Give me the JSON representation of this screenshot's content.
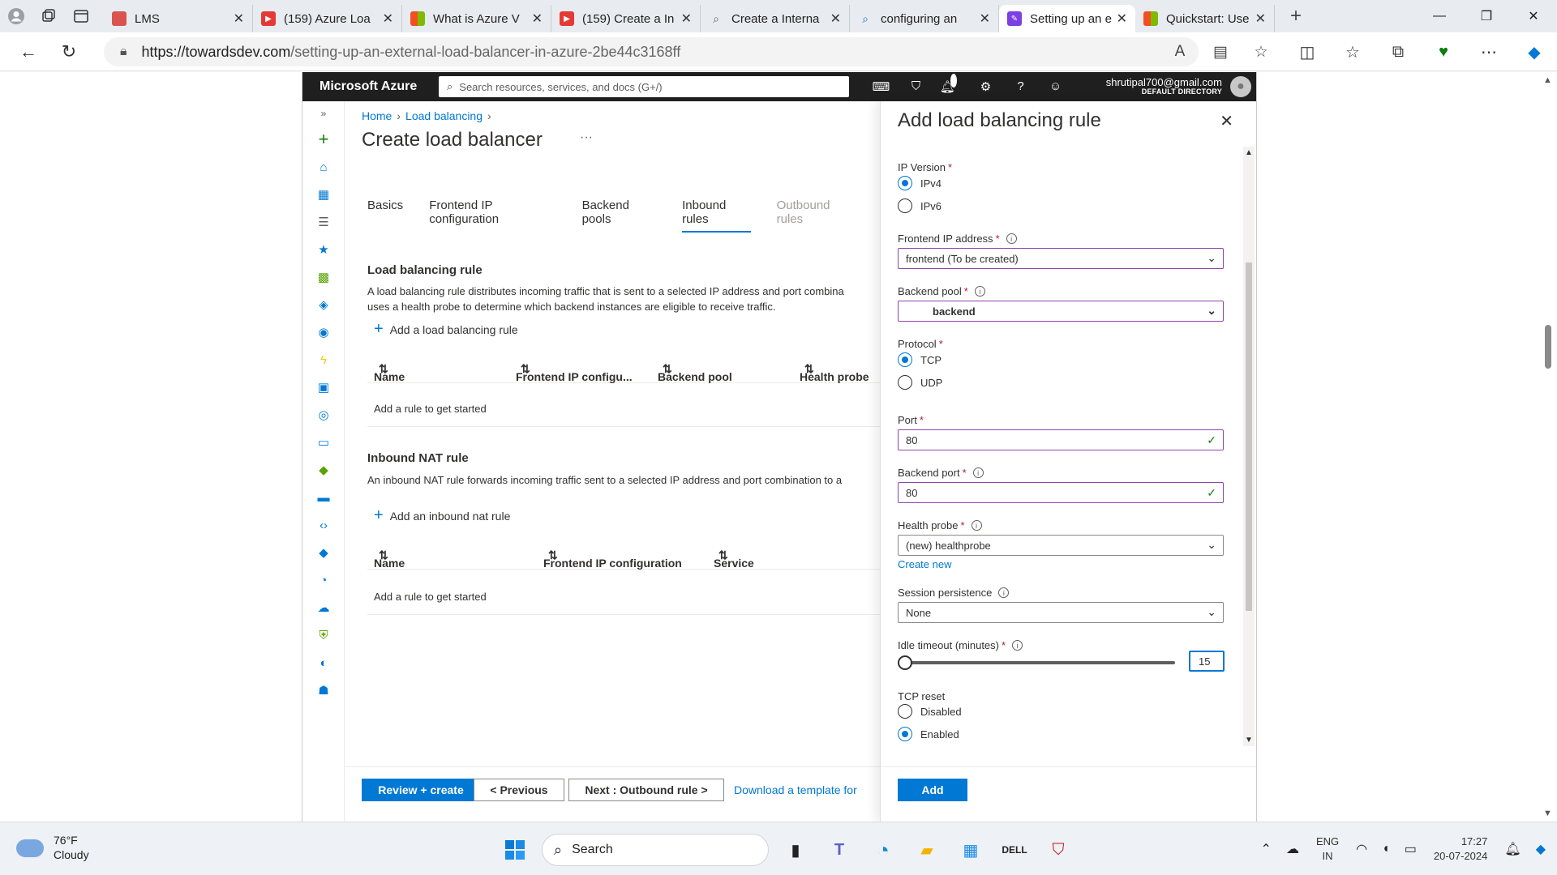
{
  "browser": {
    "tabs": [
      {
        "label": "LMS",
        "favicon_color": "#d9534f",
        "active": false
      },
      {
        "label": "(159) Azure Loa",
        "favicon_color": "#e53935",
        "active": false
      },
      {
        "label": "What is Azure V",
        "favicon_color": "#1e88e5",
        "active": false
      },
      {
        "label": "(159) Create a In",
        "favicon_color": "#e53935",
        "active": false
      },
      {
        "label": "Create a Interna",
        "favicon_color": "#5f6368",
        "active": false
      },
      {
        "label": "configuring an",
        "favicon_color": "#1a73e8",
        "active": false
      },
      {
        "label": "Setting up an e",
        "favicon_color": "#7b3fe4",
        "active": true
      },
      {
        "label": "Quickstart: Use",
        "favicon_color": "#1e88e5",
        "active": false
      }
    ],
    "url_host": "https://towardsdev.com",
    "url_path": "/setting-up-an-external-load-balancer-in-azure-2be44c3168ff"
  },
  "azure": {
    "brand": "Microsoft Azure",
    "search_placeholder": "Search resources, services, and docs (G+/)",
    "notification_count": "1",
    "user_email": "shrutipal700@gmail.com",
    "user_directory": "DEFAULT DIRECTORY",
    "left_nav_colors": [
      "#107c10",
      "#0078d4",
      "#0078d4",
      "#605e5c",
      "#0078d4",
      "#57a300",
      "#0078d4",
      "#0078d4",
      "#f2c811",
      "#0078d4",
      "#0078d4",
      "#0078d4",
      "#57a300",
      "#0078d4",
      "#0078d4",
      "#0078d4",
      "#0078d4",
      "#57a300",
      "#0078d4",
      "#0078d4"
    ],
    "breadcrumb": {
      "home": "Home",
      "section": "Load balancing"
    },
    "page_title": "Create load balancer",
    "tabs": [
      {
        "label": "Basics",
        "state": "normal"
      },
      {
        "label": "Frontend IP configuration",
        "state": "normal"
      },
      {
        "label": "Backend pools",
        "state": "normal"
      },
      {
        "label": "Inbound rules",
        "state": "selected"
      },
      {
        "label": "Outbound rules",
        "state": "disabled"
      }
    ],
    "lb_rule": {
      "title": "Load balancing rule",
      "desc_line1": "A load balancing rule distributes incoming traffic that is sent to a selected IP address and port combina",
      "desc_line2": "uses a health probe to determine which backend instances are eligible to receive traffic.",
      "add_label": "Add a load balancing rule",
      "columns": [
        "Name",
        "Frontend IP configu...",
        "Backend pool",
        "Health probe"
      ],
      "empty_text": "Add a rule to get started"
    },
    "nat_rule": {
      "title": "Inbound NAT rule",
      "desc": "An inbound NAT rule forwards incoming traffic sent to a selected IP address and port combination to a",
      "add_label": "Add an inbound nat rule",
      "columns": [
        "Name",
        "Frontend IP configuration",
        "Service"
      ],
      "empty_text": "Add a rule to get started"
    },
    "footer": {
      "review": "Review + create",
      "previous": "< Previous",
      "next": "Next : Outbound rule >",
      "download": "Download a template for"
    }
  },
  "panel": {
    "title": "Add load balancing rule",
    "ip_version": {
      "label": "IP Version",
      "options": [
        "IPv4",
        "IPv6"
      ],
      "selected": "IPv4"
    },
    "frontend_ip": {
      "label": "Frontend IP address",
      "value": "frontend (To be created)"
    },
    "backend_pool": {
      "label": "Backend pool",
      "value": "backend"
    },
    "protocol": {
      "label": "Protocol",
      "options": [
        "TCP",
        "UDP"
      ],
      "selected": "TCP"
    },
    "port": {
      "label": "Port",
      "value": "80"
    },
    "backend_port": {
      "label": "Backend port",
      "value": "80"
    },
    "health_probe": {
      "label": "Health probe",
      "value": "(new) healthprobe",
      "create_new": "Create new"
    },
    "session_persistence": {
      "label": "Session persistence",
      "value": "None"
    },
    "idle_timeout": {
      "label": "Idle timeout (minutes)",
      "value": "15",
      "slider_fraction": 0.0
    },
    "tcp_reset": {
      "label": "TCP reset",
      "options": [
        "Disabled",
        "Enabled"
      ],
      "selected": "Enabled"
    },
    "add_button": "Add"
  },
  "taskbar": {
    "weather_temp": "76°F",
    "weather_desc": "Cloudy",
    "search_label": "Search",
    "lang_line1": "ENG",
    "lang_line2": "IN",
    "time": "17:27",
    "date": "20-07-2024"
  },
  "colors": {
    "accent": "#0078d4",
    "azure_header": "#1f1f1f",
    "valid_border": "#8e44ad",
    "required": "#a4262c"
  }
}
